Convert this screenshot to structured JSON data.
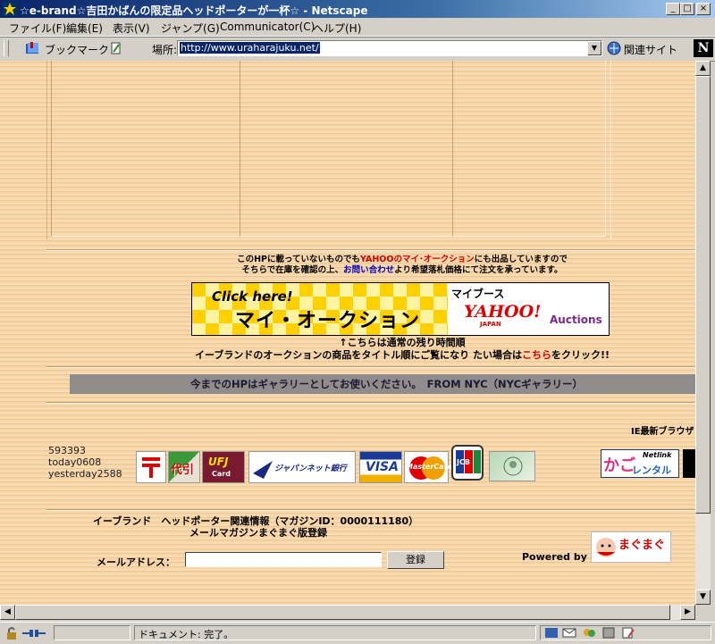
{
  "window": {
    "title": "☆e-brand☆吉田かばんの限定品ヘッドポーターが一杯☆ - Netscape",
    "min_label": "_",
    "max_label": "□",
    "close_label": "×"
  },
  "menu": [
    "ファイル(F)",
    "編集(E)",
    "表示(V)",
    "ジャンプ(G)",
    "Communicator(C)",
    "ヘルプ(H)"
  ],
  "toolbar": {
    "bookmark_label": "ブックマーク",
    "location_label": "場所:",
    "url": "http://www.uraharajuku.net/",
    "related_label": "関連サイト",
    "netscape_n": "N"
  },
  "page": {
    "notice_line1_a": "このHPに載っていないものでも",
    "notice_line1_link": "YAHOOのマイ･オークション",
    "notice_line1_b": "にも出品していますので",
    "notice_line2_a": "そちらで在庫を確認の上、",
    "notice_line2_link": "お問い合わせ",
    "notice_line2_b": "より希望落札価格にて注文を承っています。",
    "banner": {
      "click_here": "Click here!",
      "main": "マイ・オークション",
      "my_booth": "マイブース",
      "yahoo": "YAHOO!",
      "japan": "JAPAN",
      "auctions": "Auctions"
    },
    "arrow_note": "↑こちらは通常の残り時間順",
    "title_note_a": "イーブランドのオークションの商品をタイトル順にご覧になり たい場合は",
    "title_note_link": "こちら",
    "title_note_b": "をクリック!!",
    "gallery_bar": "今までのHPはギャラリーとしてお使いください。　FROM NYC（NYCギャラリー）",
    "ie_note": "IE最新ブラウザ",
    "counter": {
      "total": "593393",
      "today": "today0608",
      "yesterday": "yesterday2588"
    },
    "logos": {
      "daibiki": "代引",
      "ufj": "UFJ",
      "ufj_sub": "Card",
      "japannet": "ジャパンネット銀行",
      "visa": "VISA",
      "master": "MasterCard",
      "jcb": "JCB",
      "kago": "かご",
      "rental": "レンタル",
      "netlink": "Netlink"
    },
    "mag_line1": "イーブランド　ヘッドポーター関連情報（マガジンID：0000111180）",
    "mag_line2": "メールマガジンまぐまぐ版登録",
    "email_label": "メールアドレス：",
    "email_value": "",
    "register_button": "登録",
    "powered_by": "Powered by",
    "magmag": "まぐまぐ"
  },
  "status": {
    "text": "ドキュメント: 完了。"
  },
  "colors": {
    "link_red": "#d40000",
    "link_blue": "#0000c0",
    "gallery_bar_bg": "#908c8c"
  }
}
